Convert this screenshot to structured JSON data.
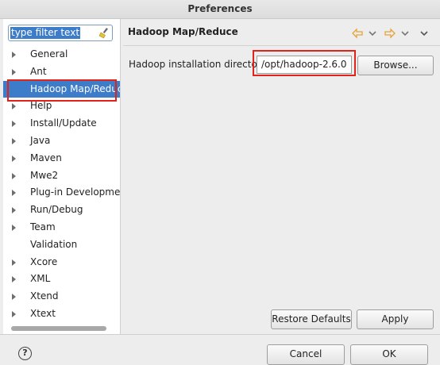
{
  "window": {
    "title": "Preferences"
  },
  "filter": {
    "value": "type filter text",
    "icon": "broom-icon"
  },
  "tree": [
    {
      "label": "General",
      "has_children": true
    },
    {
      "label": "Ant",
      "has_children": true
    },
    {
      "label": "Hadoop Map/Reduce",
      "has_children": false,
      "selected": true
    },
    {
      "label": "Help",
      "has_children": true
    },
    {
      "label": "Install/Update",
      "has_children": true
    },
    {
      "label": "Java",
      "has_children": true
    },
    {
      "label": "Maven",
      "has_children": true
    },
    {
      "label": "Mwe2",
      "has_children": true
    },
    {
      "label": "Plug-in Development",
      "has_children": true
    },
    {
      "label": "Run/Debug",
      "has_children": true
    },
    {
      "label": "Team",
      "has_children": true
    },
    {
      "label": "Validation",
      "has_children": false
    },
    {
      "label": "Xcore",
      "has_children": true
    },
    {
      "label": "XML",
      "has_children": true
    },
    {
      "label": "Xtend",
      "has_children": true
    },
    {
      "label": "Xtext",
      "has_children": true
    }
  ],
  "page": {
    "title": "Hadoop Map/Reduce",
    "field_label": "Hadoop installation directory:",
    "field_value": "/opt/hadoop-2.6.0",
    "browse_label": "Browse..."
  },
  "buttons": {
    "restore_defaults": "Restore Defaults",
    "apply": "Apply",
    "cancel": "Cancel",
    "ok": "OK",
    "help": "?"
  },
  "colors": {
    "selection": "#3d7cc9",
    "highlight_box": "#e2231a",
    "nav_arrow": "#e8a23a"
  }
}
